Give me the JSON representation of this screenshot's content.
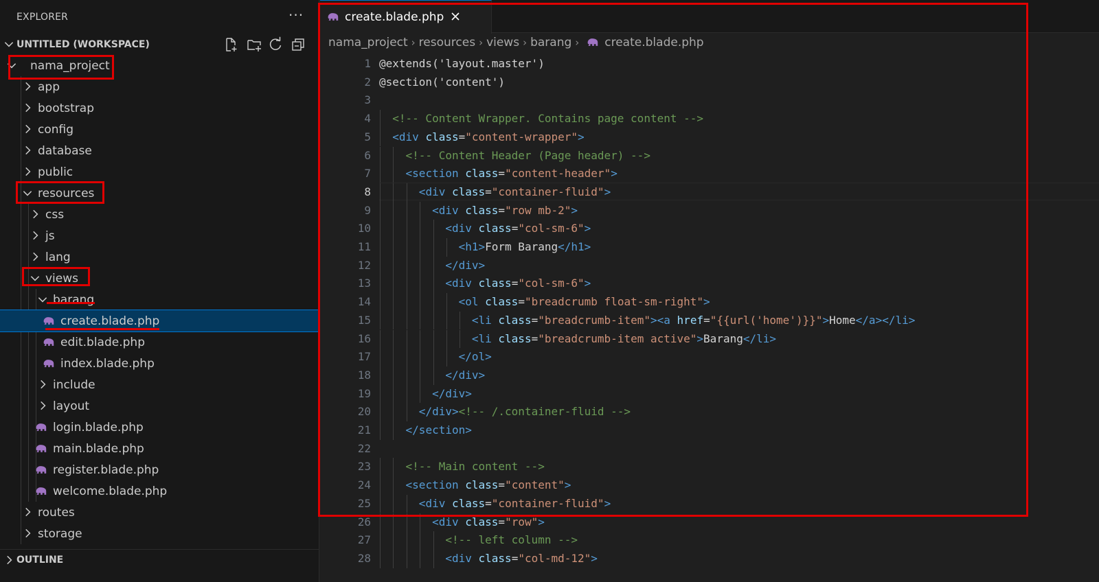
{
  "explorer": {
    "title": "EXPLORER",
    "more_icon": "ellipsis-icon",
    "workspace_label": "UNTITLED (WORKSPACE)",
    "workspace_actions": [
      "new-file-icon",
      "new-folder-icon",
      "refresh-icon",
      "collapse-all-icon"
    ],
    "tree": [
      {
        "label": "nama_project",
        "type": "folder",
        "expanded": true
      },
      {
        "label": "app",
        "type": "folder",
        "expanded": false
      },
      {
        "label": "bootstrap",
        "type": "folder",
        "expanded": false
      },
      {
        "label": "config",
        "type": "folder",
        "expanded": false
      },
      {
        "label": "database",
        "type": "folder",
        "expanded": false
      },
      {
        "label": "public",
        "type": "folder",
        "expanded": false
      },
      {
        "label": "resources",
        "type": "folder",
        "expanded": true
      },
      {
        "label": "css",
        "type": "folder",
        "expanded": false
      },
      {
        "label": "js",
        "type": "folder",
        "expanded": false
      },
      {
        "label": "lang",
        "type": "folder",
        "expanded": false
      },
      {
        "label": "views",
        "type": "folder",
        "expanded": true
      },
      {
        "label": "barang",
        "type": "folder",
        "expanded": true
      },
      {
        "label": "create.blade.php",
        "type": "file",
        "selected": true
      },
      {
        "label": "edit.blade.php",
        "type": "file"
      },
      {
        "label": "index.blade.php",
        "type": "file"
      },
      {
        "label": "include",
        "type": "folder",
        "expanded": false
      },
      {
        "label": "layout",
        "type": "folder",
        "expanded": false
      },
      {
        "label": "login.blade.php",
        "type": "file"
      },
      {
        "label": "main.blade.php",
        "type": "file"
      },
      {
        "label": "register.blade.php",
        "type": "file"
      },
      {
        "label": "welcome.blade.php",
        "type": "file"
      },
      {
        "label": "routes",
        "type": "folder",
        "expanded": false
      },
      {
        "label": "storage",
        "type": "folder",
        "expanded": false
      }
    ],
    "outline_label": "OUTLINE"
  },
  "editor": {
    "tab": {
      "label": "create.blade.php",
      "icon": "php-elephant-icon",
      "close_icon": "close-icon"
    },
    "breadcrumb": [
      "nama_project",
      "resources",
      "views",
      "barang",
      "create.blade.php"
    ],
    "active_line": 8,
    "lines": [
      {
        "n": "1",
        "t": "@extends('layout.master')"
      },
      {
        "n": "2",
        "t": "@section('content')"
      },
      {
        "n": "3",
        "t": ""
      },
      {
        "n": "4",
        "t": "  <!-- Content Wrapper. Contains page content -->"
      },
      {
        "n": "5",
        "t": "  <div class=\"content-wrapper\">"
      },
      {
        "n": "6",
        "t": "    <!-- Content Header (Page header) -->"
      },
      {
        "n": "7",
        "t": "    <section class=\"content-header\">"
      },
      {
        "n": "8",
        "t": "      <div class=\"container-fluid\">"
      },
      {
        "n": "9",
        "t": "        <div class=\"row mb-2\">"
      },
      {
        "n": "10",
        "t": "          <div class=\"col-sm-6\">"
      },
      {
        "n": "11",
        "t": "            <h1>Form Barang</h1>"
      },
      {
        "n": "12",
        "t": "          </div>"
      },
      {
        "n": "13",
        "t": "          <div class=\"col-sm-6\">"
      },
      {
        "n": "14",
        "t": "            <ol class=\"breadcrumb float-sm-right\">"
      },
      {
        "n": "15",
        "t": "              <li class=\"breadcrumb-item\"><a href=\"{{url('home')}}\">Home</a></li>"
      },
      {
        "n": "16",
        "t": "              <li class=\"breadcrumb-item active\">Barang</li>"
      },
      {
        "n": "17",
        "t": "            </ol>"
      },
      {
        "n": "18",
        "t": "          </div>"
      },
      {
        "n": "19",
        "t": "        </div>"
      },
      {
        "n": "20",
        "t": "      </div><!-- /.container-fluid -->"
      },
      {
        "n": "21",
        "t": "    </section>"
      },
      {
        "n": "22",
        "t": ""
      },
      {
        "n": "23",
        "t": "    <!-- Main content -->"
      },
      {
        "n": "24",
        "t": "    <section class=\"content\">"
      },
      {
        "n": "25",
        "t": "      <div class=\"container-fluid\">"
      },
      {
        "n": "26",
        "t": "        <div class=\"row\">"
      },
      {
        "n": "27",
        "t": "          <!-- left column -->"
      },
      {
        "n": "28",
        "t": "          <div class=\"col-md-12\">"
      }
    ]
  },
  "colors": {
    "annotation_red": "#e00000",
    "selection_bg": "#04395e",
    "php_icon": "#a074c4"
  }
}
